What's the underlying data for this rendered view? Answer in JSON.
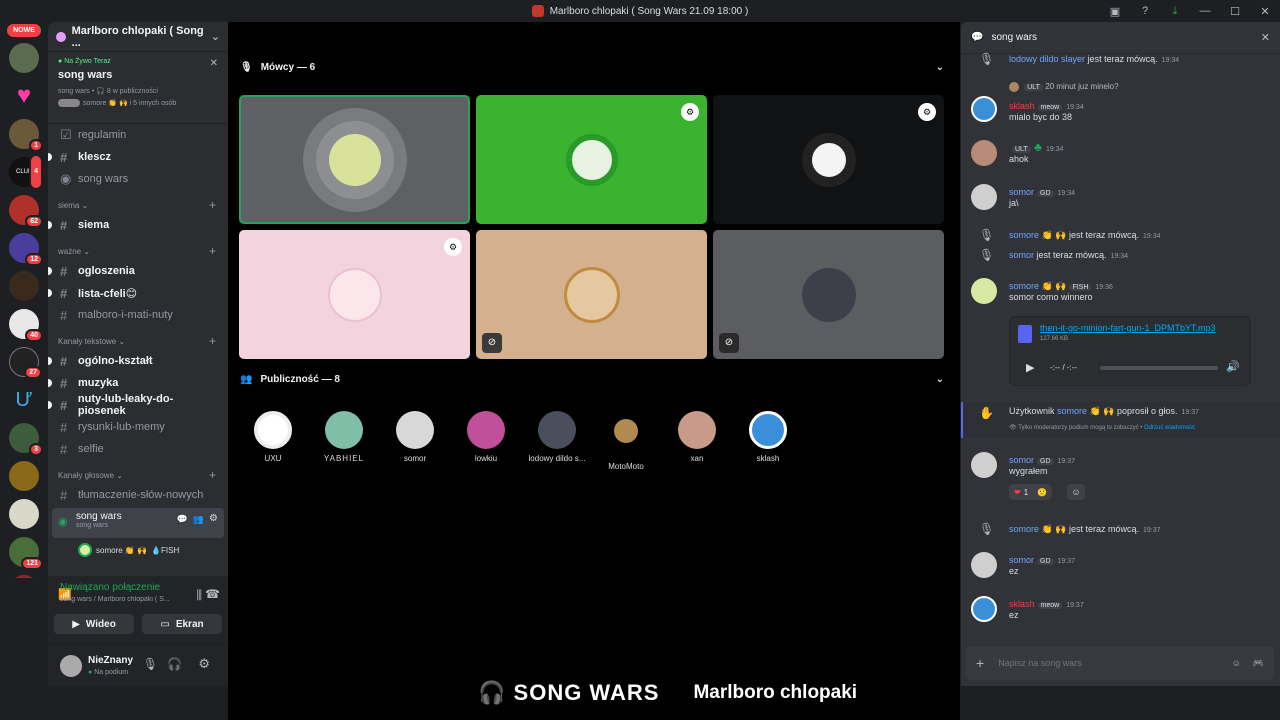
{
  "window": {
    "title": "Marlboro chlopaki ( Song Wars 21.09 18:00 )"
  },
  "guilds": {
    "new_label": "NOWE",
    "badges": [
      "1",
      "4",
      "62",
      "12",
      "40",
      "27",
      "3",
      "121",
      "11"
    ]
  },
  "server": {
    "name": "Marlboro chlopaki ( Song ..."
  },
  "live": {
    "label": "Na Żywo Teraz",
    "title": "song wars",
    "stats_channel": "song wars",
    "stats_audience": "8 w publiczności",
    "speakers": "somore 👏 🙌 i 5 innych osób"
  },
  "channels": {
    "top": [
      {
        "name": "regulamin"
      },
      {
        "name": "klescz"
      },
      {
        "name": "song wars"
      }
    ],
    "cat_siema": "siema",
    "siema": [
      {
        "name": "siema"
      }
    ],
    "cat_wazne": "ważne",
    "wazne": [
      {
        "name": "ogloszenia"
      },
      {
        "name": "lista-cfeli😊"
      },
      {
        "name": "malboro-i-mati-nuty"
      }
    ],
    "cat_text": "Kanały tekstowe",
    "text": [
      {
        "name": "ogólno-kształt"
      },
      {
        "name": "muzyka"
      },
      {
        "name": "nuty-lub-leaky-do-piosenek"
      },
      {
        "name": "rysunki-lub-memy"
      },
      {
        "name": "selfie"
      }
    ],
    "cat_voice": "Kanały głosowe",
    "voice": [
      {
        "name": "tłumaczenie-słów-nowych"
      }
    ],
    "stage": {
      "name": "song wars",
      "sub": "song wars",
      "member": "somore 👏 🙌",
      "member_tag": "FISH"
    }
  },
  "connection": {
    "status": "Nawiązano połączenie",
    "where": "song wars / Marlboro chlopaki ( S...",
    "video": "Wideo",
    "screen": "Ekran"
  },
  "user": {
    "name": "NieZnany",
    "status": "Na podium"
  },
  "stage": {
    "speakers_label": "Mówcy — 6",
    "audience_label": "Publiczność — 8"
  },
  "audience": [
    {
      "name": "UXU"
    },
    {
      "name": "YABHIEL"
    },
    {
      "name": "somor"
    },
    {
      "name": "lowkiu"
    },
    {
      "name": "lodowy dildo s..."
    },
    {
      "name": "MotoMoto"
    },
    {
      "name": "xan"
    },
    {
      "name": "sklash"
    }
  ],
  "overlay": {
    "left": "SONG WARS",
    "right": "Marlboro chlopaki"
  },
  "chat": {
    "title": "song wars",
    "m0": {
      "name": "lodowy dildo slayer",
      "text": "jest teraz mówcą.",
      "time": "19:34"
    },
    "m1": {
      "reply_tag": "ULT",
      "reply_text": "20 minut juz minelo?",
      "name": "sklash",
      "tag": "meow",
      "time": "19:34",
      "text": "mialo byc do 38"
    },
    "m2": {
      "tag": "ULT",
      "time": "19:34",
      "text": "ahok"
    },
    "m3": {
      "name": "somor",
      "tag": "GD",
      "time": "19:34",
      "text": "ja\\"
    },
    "m4": {
      "name": "somore 👏 🙌",
      "text": "jest teraz mówcą.",
      "time": "19:34"
    },
    "m5": {
      "name": "somor",
      "text": "jest teraz mówcą.",
      "time": "19:34"
    },
    "m6": {
      "name": "somore 👏 🙌",
      "tag": "FISH",
      "time": "19:36",
      "text": "somor como winnero"
    },
    "file": {
      "name": "then-it-go-minion-fart-gun-1_DPMTbYT.mp3",
      "size": "127.66 KB",
      "time": "-:-- / -:--"
    },
    "m7": {
      "prefix": "Użytkownik",
      "name": "somore 👏 🙌",
      "text": "poprosił o głos.",
      "time": "19:37",
      "note": "Tylko moderatorzy podium mogą to zobaczyć •",
      "link": "Odrzuć wiadomość"
    },
    "m8": {
      "name": "somor",
      "tag": "GD",
      "time": "19:37",
      "text": "wygrałem",
      "reaction_count": "1"
    },
    "m9": {
      "name": "somore 👏 🙌",
      "text": "jest teraz mówcą.",
      "time": "19:37"
    },
    "m10": {
      "name": "somor",
      "tag": "GD",
      "time": "19:37",
      "text": "ez"
    },
    "m11": {
      "name": "sklash",
      "tag": "meow",
      "time": "19:37",
      "text": "ez"
    },
    "placeholder": "Napisz na song wars"
  }
}
